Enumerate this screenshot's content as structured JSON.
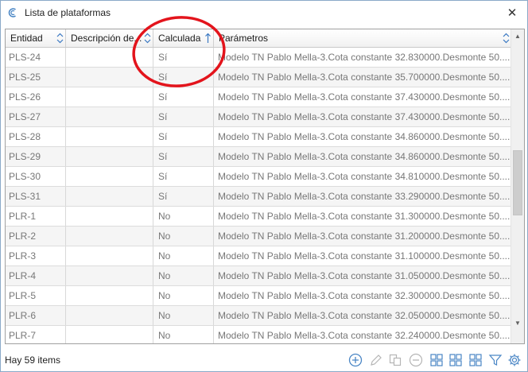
{
  "window": {
    "title": "Lista de plataformas",
    "close_label": "✕"
  },
  "columns": [
    {
      "label": "Entidad"
    },
    {
      "label": "Descripción de..."
    },
    {
      "label": "Calculada"
    },
    {
      "label": "Parámetros"
    }
  ],
  "rows": [
    {
      "entidad": "PLS-24",
      "descripcion": "",
      "calculada": "Sí",
      "parametros": "Modelo TN Pablo Mella-3.Cota constante 32.830000.Desmonte 50...."
    },
    {
      "entidad": "PLS-25",
      "descripcion": "",
      "calculada": "Sí",
      "parametros": "Modelo TN Pablo Mella-3.Cota constante 35.700000.Desmonte 50...."
    },
    {
      "entidad": "PLS-26",
      "descripcion": "",
      "calculada": "Sí",
      "parametros": "Modelo TN Pablo Mella-3.Cota constante 37.430000.Desmonte 50...."
    },
    {
      "entidad": "PLS-27",
      "descripcion": "",
      "calculada": "Sí",
      "parametros": "Modelo TN Pablo Mella-3.Cota constante 37.430000.Desmonte 50...."
    },
    {
      "entidad": "PLS-28",
      "descripcion": "",
      "calculada": "Sí",
      "parametros": "Modelo TN Pablo Mella-3.Cota constante 34.860000.Desmonte 50...."
    },
    {
      "entidad": "PLS-29",
      "descripcion": "",
      "calculada": "Sí",
      "parametros": "Modelo TN Pablo Mella-3.Cota constante 34.860000.Desmonte 50...."
    },
    {
      "entidad": "PLS-30",
      "descripcion": "",
      "calculada": "Sí",
      "parametros": "Modelo TN Pablo Mella-3.Cota constante 34.810000.Desmonte 50...."
    },
    {
      "entidad": "PLS-31",
      "descripcion": "",
      "calculada": "Sí",
      "parametros": "Modelo TN Pablo Mella-3.Cota constante 33.290000.Desmonte 50...."
    },
    {
      "entidad": "PLR-1",
      "descripcion": "",
      "calculada": "No",
      "parametros": "Modelo TN Pablo Mella-3.Cota constante 31.300000.Desmonte 50...."
    },
    {
      "entidad": "PLR-2",
      "descripcion": "",
      "calculada": "No",
      "parametros": "Modelo TN Pablo Mella-3.Cota constante 31.200000.Desmonte 50...."
    },
    {
      "entidad": "PLR-3",
      "descripcion": "",
      "calculada": "No",
      "parametros": "Modelo TN Pablo Mella-3.Cota constante 31.100000.Desmonte 50...."
    },
    {
      "entidad": "PLR-4",
      "descripcion": "",
      "calculada": "No",
      "parametros": "Modelo TN Pablo Mella-3.Cota constante 31.050000.Desmonte 50...."
    },
    {
      "entidad": "PLR-5",
      "descripcion": "",
      "calculada": "No",
      "parametros": "Modelo TN Pablo Mella-3.Cota constante 32.300000.Desmonte 50...."
    },
    {
      "entidad": "PLR-6",
      "descripcion": "",
      "calculada": "No",
      "parametros": "Modelo TN Pablo Mella-3.Cota constante 32.050000.Desmonte 50...."
    },
    {
      "entidad": "PLR-7",
      "descripcion": "",
      "calculada": "No",
      "parametros": "Modelo TN Pablo Mella-3.Cota constante 32.240000.Desmonte 50...."
    }
  ],
  "status": {
    "items_text": "Hay 59 items"
  },
  "toolbar": {
    "icons": [
      "add-icon",
      "edit-icon",
      "copy-icon",
      "remove-icon",
      "grid-view-icon",
      "grid-view-2-icon",
      "grid-view-3-icon",
      "filter-icon",
      "settings-icon"
    ]
  },
  "colors": {
    "accent": "#2b6cb0",
    "annotation": "#e3141c"
  }
}
